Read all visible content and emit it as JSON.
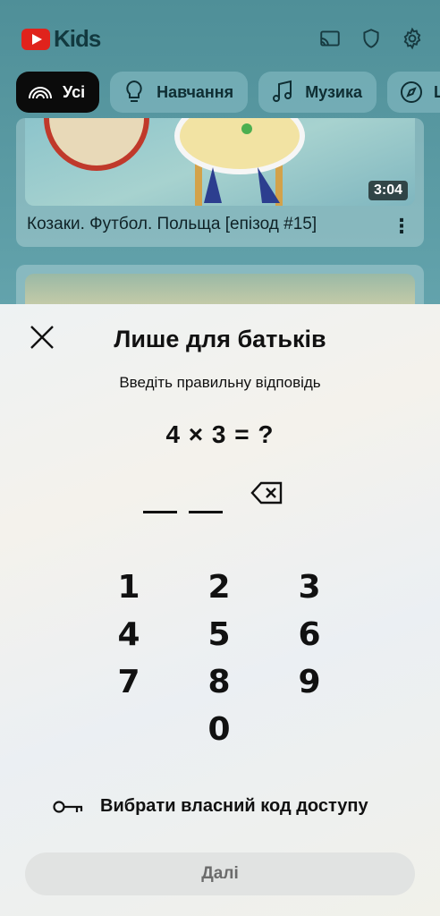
{
  "app": {
    "logo_text": "Kids",
    "brand_color": "#e0231c",
    "top_icons": [
      "cast-icon",
      "shield-icon",
      "gear-icon"
    ]
  },
  "chips": [
    {
      "label": "Усі",
      "icon": "rainbow-icon",
      "active": true
    },
    {
      "label": "Навчання",
      "icon": "lightbulb-icon",
      "active": false
    },
    {
      "label": "Музика",
      "icon": "music-note-icon",
      "active": false
    },
    {
      "label": "Ц",
      "icon": "compass-icon",
      "active": false
    }
  ],
  "videos": [
    {
      "title": "Козаки. Футбол. Польща [епізод #15]",
      "duration": "3:04"
    }
  ],
  "parent_gate": {
    "title": "Лише для батьків",
    "instruction": "Введіть правильну відповідь",
    "question": "4 × 3 = ?",
    "answer_digits": [
      "",
      ""
    ],
    "keypad": [
      "1",
      "2",
      "3",
      "4",
      "5",
      "6",
      "7",
      "8",
      "9",
      "0"
    ],
    "custom_code_label": "Вибрати власний код доступу",
    "next_label": "Далі"
  }
}
